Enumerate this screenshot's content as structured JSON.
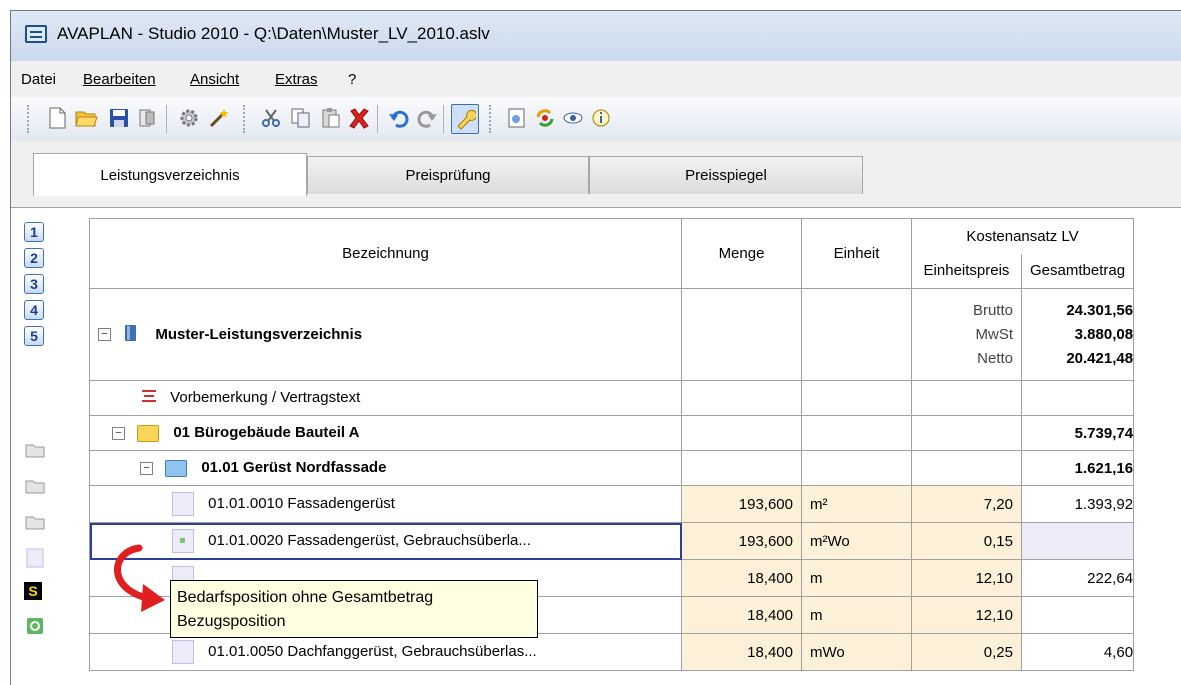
{
  "window": {
    "title": "AVAPLAN - Studio 2010 - Q:\\Daten\\Muster_LV_2010.aslv"
  },
  "menu": {
    "items": [
      {
        "label": "Datei"
      },
      {
        "label": "Bearbeiten"
      },
      {
        "label": "Ansicht"
      },
      {
        "label": "Extras"
      },
      {
        "label": "?"
      }
    ]
  },
  "toolbar": {
    "icons": [
      "new-document-icon",
      "open-folder-icon",
      "save-icon",
      "print-icon",
      "settings-gear-icon",
      "magic-wand-icon",
      "cut-icon",
      "copy-icon",
      "paste-icon",
      "delete-icon",
      "undo-icon",
      "redo-icon",
      "tool-wrench-icon",
      "export-icon",
      "refresh-icon",
      "preview-eye-icon",
      "info-icon"
    ]
  },
  "tabs": [
    {
      "label": "Leistungsverzeichnis",
      "active": true
    },
    {
      "label": "Preisprüfung",
      "active": false
    },
    {
      "label": "Preisspiegel",
      "active": false
    }
  ],
  "levels": [
    "1",
    "2",
    "3",
    "4",
    "5"
  ],
  "table": {
    "headers": {
      "bezeichnung": "Bezeichnung",
      "menge": "Menge",
      "einheit": "Einheit",
      "group": "Kostenansatz LV",
      "einheitspreis": "Einheitspreis",
      "gesamtbetrag": "Gesamtbetrag"
    },
    "root": {
      "title": "Muster-Leistungsverzeichnis",
      "labels": [
        "Brutto",
        "MwSt",
        "Netto"
      ],
      "values": [
        "24.301,56",
        "3.880,08",
        "20.421,48"
      ]
    },
    "rows": [
      {
        "kind": "text",
        "label": "Vorbemerkung / Vertragstext",
        "menge": "",
        "einheit": "",
        "ep": "",
        "gb": ""
      },
      {
        "kind": "group1",
        "label": "01  Bürogebäude Bauteil A",
        "menge": "",
        "einheit": "",
        "ep": "",
        "gb": "5.739,74"
      },
      {
        "kind": "group2",
        "label": "01.01  Gerüst Nordfassade",
        "menge": "",
        "einheit": "",
        "ep": "",
        "gb": "1.621,16"
      },
      {
        "kind": "pos",
        "label": "01.01.0010  Fassadengerüst",
        "menge": "193,600",
        "einheit": "m²",
        "ep": "7,20",
        "gb": "1.393,92"
      },
      {
        "kind": "pos-selected",
        "label": "01.01.0020  Fassadengerüst, Gebrauchsüberla...",
        "menge": "193,600",
        "einheit": "m²Wo",
        "ep": "0,15",
        "gb": ""
      },
      {
        "kind": "pos",
        "label": "",
        "menge": "18,400",
        "einheit": "m",
        "ep": "12,10",
        "gb": "222,64"
      },
      {
        "kind": "pos",
        "label": "",
        "menge": "18,400",
        "einheit": "m",
        "ep": "12,10",
        "gb": ""
      },
      {
        "kind": "pos",
        "label": "01.01.0050  Dachfanggerüst, Gebrauchsüberlas...",
        "menge": "18,400",
        "einheit": "mWo",
        "ep": "0,25",
        "gb": "4,60"
      }
    ]
  },
  "tooltip": {
    "line1": "Bedarfsposition ohne Gesamtbetrag",
    "line2": "Bezugsposition"
  },
  "side_markers": {
    "s_badge": "S"
  },
  "colors": {
    "peach": "#fdf0d8",
    "lavender": "#ececf9",
    "selection": "#2b3f99",
    "tooltip_bg": "#ffffe1",
    "arrow": "#e02020"
  }
}
